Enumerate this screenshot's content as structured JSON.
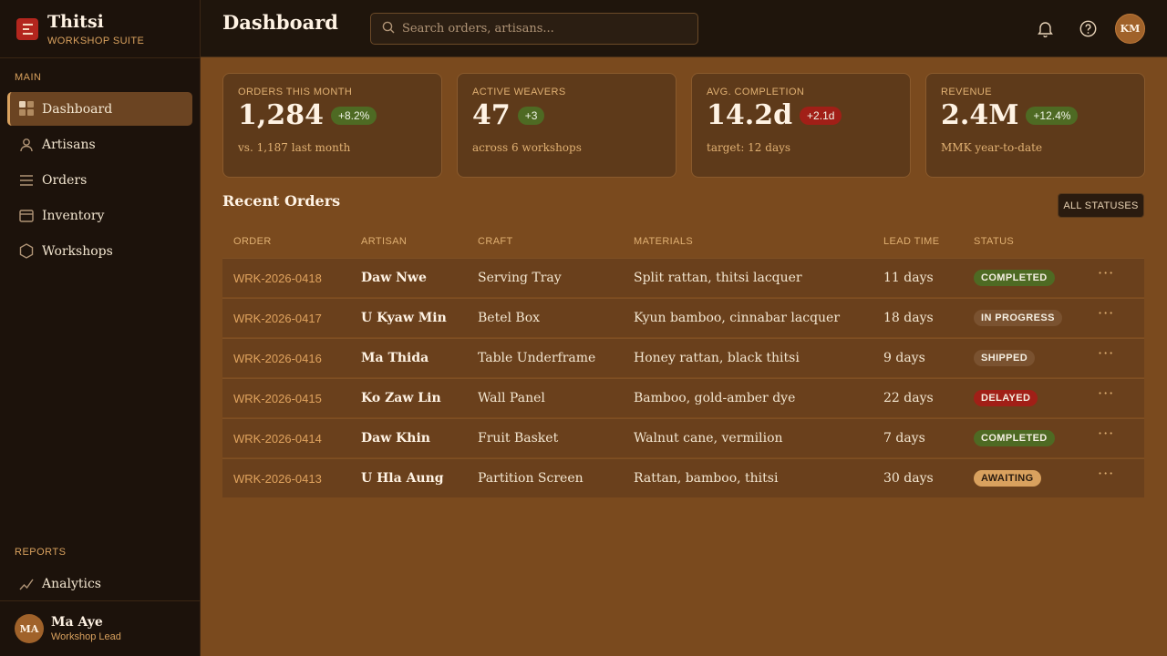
{
  "brand": {
    "name": "Thitsi",
    "subtitle": "WORKSHOP SUITE"
  },
  "sidebar": {
    "main_label": "MAIN",
    "items": [
      {
        "label": "Dashboard",
        "icon": "grid-icon",
        "active": true
      },
      {
        "label": "Artisans",
        "icon": "user-icon"
      },
      {
        "label": "Orders",
        "icon": "list-icon"
      },
      {
        "label": "Inventory",
        "icon": "box-icon"
      },
      {
        "label": "Workshops",
        "icon": "hexagon-icon"
      }
    ],
    "reports_label": "REPORTS",
    "reports_items": [
      {
        "label": "Analytics",
        "icon": "chart-line-icon"
      }
    ],
    "user": {
      "initials": "MA",
      "name": "Ma Aye",
      "role": "Workshop Lead"
    }
  },
  "header": {
    "title": "Dashboard",
    "search": {
      "placeholder": "Search orders, artisans...",
      "value": ""
    },
    "avatar_initials": "KM"
  },
  "stats": [
    {
      "label": "ORDERS THIS MONTH",
      "value": "1,284",
      "delta": "+8.2%",
      "delta_type": "positive",
      "note": "vs. 1,187 last month"
    },
    {
      "label": "ACTIVE WEAVERS",
      "value": "47",
      "delta": "+3",
      "delta_type": "positive",
      "note": "across 6 workshops"
    },
    {
      "label": "AVG. COMPLETION",
      "value": "14.2d",
      "delta": "+2.1d",
      "delta_type": "negative",
      "note": "target: 12 days"
    },
    {
      "label": "REVENUE",
      "value": "2.4M",
      "delta": "+12.4%",
      "delta_type": "positive",
      "note": "MMK year-to-date"
    }
  ],
  "orders": {
    "title": "Recent Orders",
    "filter_label": "ALL STATUSES",
    "columns": [
      "ORDER",
      "ARTISAN",
      "CRAFT",
      "MATERIALS",
      "LEAD TIME",
      "STATUS"
    ],
    "rows": [
      {
        "order": "WRK-2026-0418",
        "artisan": "Daw Nwe",
        "craft": "Serving Tray",
        "materials": "Split rattan, thitsi lacquer",
        "lead": "11 days",
        "status": "COMPLETED"
      },
      {
        "order": "WRK-2026-0417",
        "artisan": "U Kyaw Min",
        "craft": "Betel Box",
        "materials": "Kyun bamboo, cinnabar lacquer",
        "lead": "18 days",
        "status": "IN PROGRESS"
      },
      {
        "order": "WRK-2026-0416",
        "artisan": "Ma Thida",
        "craft": "Table Underframe",
        "materials": "Honey rattan, black thitsi",
        "lead": "9 days",
        "status": "SHIPPED"
      },
      {
        "order": "WRK-2026-0415",
        "artisan": "Ko Zaw Lin",
        "craft": "Wall Panel",
        "materials": "Bamboo, gold-amber dye",
        "lead": "22 days",
        "status": "DELAYED"
      },
      {
        "order": "WRK-2026-0414",
        "artisan": "Daw Khin",
        "craft": "Fruit Basket",
        "materials": "Walnut cane, vermilion",
        "lead": "7 days",
        "status": "COMPLETED"
      },
      {
        "order": "WRK-2026-0413",
        "artisan": "U Hla Aung",
        "craft": "Partition Screen",
        "materials": "Rattan, bamboo, thitsi",
        "lead": "30 days",
        "status": "AWAITING"
      }
    ],
    "more_label": "···"
  },
  "status_colors": {
    "COMPLETED": "#4e6a23",
    "IN PROGRESS": "#7a5230",
    "SHIPPED": "#7a5230",
    "DELAYED": "#a11f17",
    "AWAITING": "#d9a15e"
  },
  "colors": {
    "accent": "#d9a15e",
    "background": "#7a4a1e",
    "sidebar": "#1c120b",
    "negative": "#a11f17",
    "positive": "#4e6a23"
  }
}
